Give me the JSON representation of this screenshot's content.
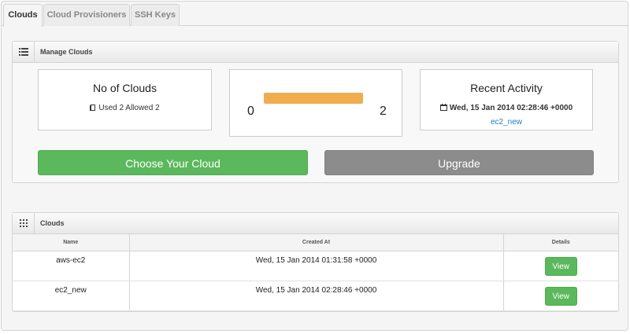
{
  "tabs": [
    "Clouds",
    "Cloud Provisioners",
    "SSH Keys"
  ],
  "manage": {
    "title": "Manage Clouds",
    "count_title": "No of Clouds",
    "usage": "Used 2 Allowed 2",
    "usage_level": 1.0,
    "bar_min": "0",
    "bar_max": "2",
    "activity_title": "Recent Activity",
    "activity_time": "Wed, 15 Jan 2014 02:28:46 +0000",
    "activity_link": "ec2_new",
    "choose_label": "Choose Your Cloud",
    "upgrade_label": "Upgrade"
  },
  "clouds": {
    "title": "Clouds",
    "headers": [
      "Name",
      "Created At",
      "Details"
    ],
    "rows": [
      {
        "name": "aws-ec2",
        "created": "Wed, 15 Jan 2014 01:31:58 +0000",
        "action": "View"
      },
      {
        "name": "ec2_new",
        "created": "Wed, 15 Jan 2014 02:28:46 +0000",
        "action": "View"
      }
    ]
  },
  "colors": {
    "success": "#5cb85c",
    "warning": "#f0ad4e",
    "muted": "#8c8c8c",
    "link": "#1f7bc4"
  }
}
